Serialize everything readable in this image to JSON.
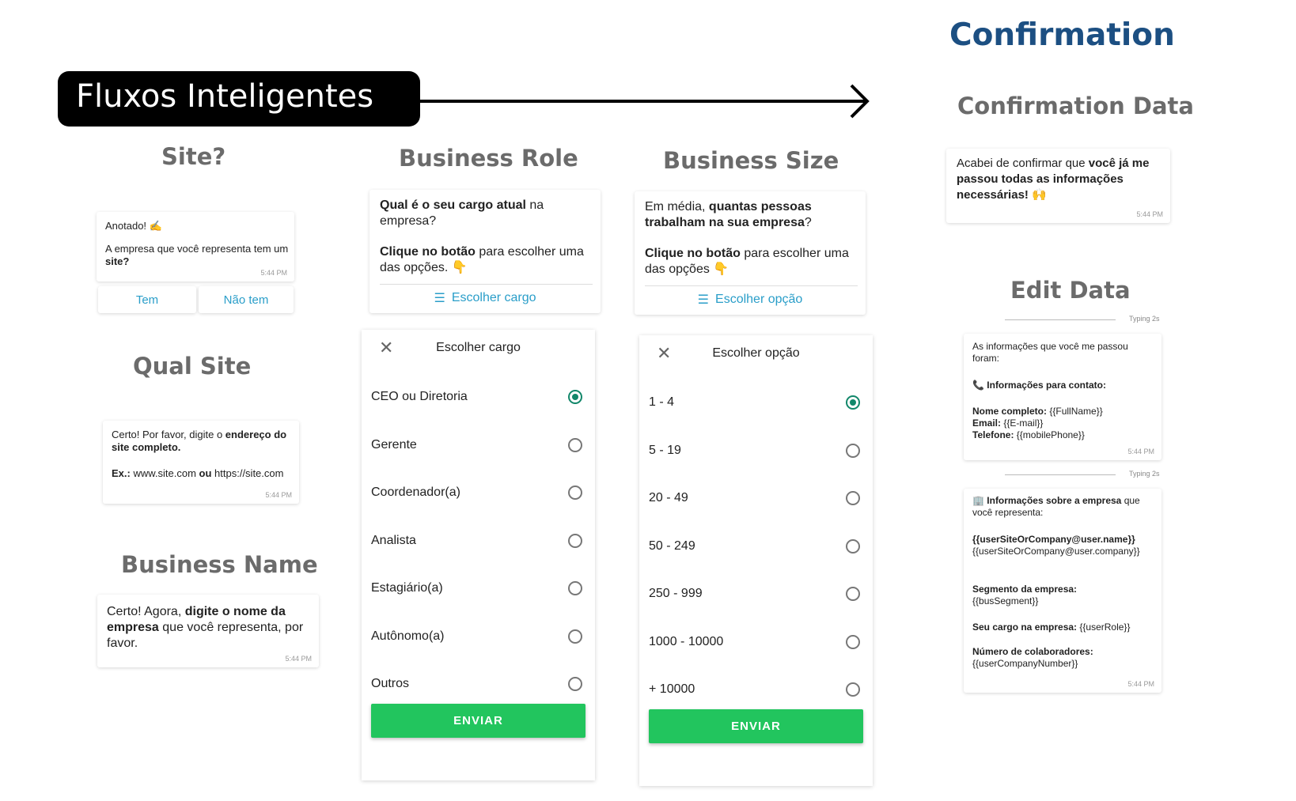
{
  "banner": {
    "title": "Fluxos Inteligentes"
  },
  "confirmation": {
    "title": "Confirmation",
    "data_heading": "Confirmation Data",
    "edit_heading": "Edit Data"
  },
  "site": {
    "heading": "Site?",
    "msg_line1": "Anotado! ✍️",
    "msg_line2a": "A empresa que você representa tem um ",
    "msg_line2b": "site?",
    "time": "5:44 PM",
    "btn_tem": "Tem",
    "btn_nao_tem": "Não tem"
  },
  "qual_site": {
    "heading": "Qual Site",
    "p1a": "Certo! Por favor, digite o ",
    "p1b": "endereço do site completo.",
    "p2a": "Ex.:",
    "p2b": " www.site.com ",
    "p2c": "ou",
    "p2d": " https://site.com",
    "time": "5:44 PM"
  },
  "business_name": {
    "heading": "Business Name",
    "p1a": "Certo! Agora, ",
    "p1b": "digite o nome da empresa",
    "p1c": " que você representa, por favor.",
    "time": "5:44 PM"
  },
  "business_role": {
    "heading": "Business Role",
    "q1b": "Qual é o seu cargo atual",
    "q1c": " na empresa?",
    "q2b": "Clique no botão",
    "q2c": " para escolher uma das opções. 👇",
    "list_button": "Escolher cargo",
    "panel_title": "Escolher cargo",
    "options": [
      "CEO ou Diretoria",
      "Gerente",
      "Coordenador(a)",
      "Analista",
      "Estagiário(a)",
      "Autônomo(a)",
      "Outros"
    ],
    "selected_index": 0,
    "submit": "ENVIAR"
  },
  "business_size": {
    "heading": "Business Size",
    "q1a": "Em média, ",
    "q1b": "quantas pessoas trabalham na sua empresa",
    "q1c": "?",
    "q2b": "Clique no botão",
    "q2c": " para escolher uma das opções 👇",
    "list_button": "Escolher opção",
    "panel_title": "Escolher opção",
    "options": [
      "1 - 4",
      "5 - 19",
      "20 - 49",
      "50 - 249",
      "250 - 999",
      "1000 - 10000",
      "+ 10000"
    ],
    "selected_index": 0,
    "submit": "ENVIAR"
  },
  "confirm_msg": {
    "a": "Acabei de confirmar que ",
    "b": "você já me passou todas as informações necessárias!",
    "c": " 🙌",
    "time": "5:44 PM"
  },
  "edit1": {
    "typing": "Typing 2s",
    "intro": "As informações que você me passou foram:",
    "contact_title": "📞 Informações para contato:",
    "name_label": "Nome completo:",
    "name_value": " {{FullName}}",
    "email_label": "Email:",
    "email_value": " {{E-mail}}",
    "phone_label": "Telefone:",
    "phone_value": " {{mobilePhone}}",
    "time": "5:44 PM"
  },
  "edit2": {
    "typing": "Typing 2s",
    "title_bold": "🏢 Informações sobre a empresa",
    "title_rest": " que você representa:",
    "site_bold": "{{userSiteOrCompany@user.name}}",
    "site_rest": "{{userSiteOrCompany@user.company}}",
    "segment_label": "Segmento da empresa:",
    "segment_value": "{{busSegment}}",
    "role_label": "Seu cargo na empresa:",
    "role_value": " {{userRole}}",
    "collab_label": "Número de colaboradores:",
    "collab_value": "{{userCompanyNumber}}",
    "time": "5:44 PM"
  },
  "colors": {
    "accent_blue": "#1c4f82",
    "link": "#2a9ec9",
    "radio": "#12876a",
    "submit": "#22c55e"
  }
}
